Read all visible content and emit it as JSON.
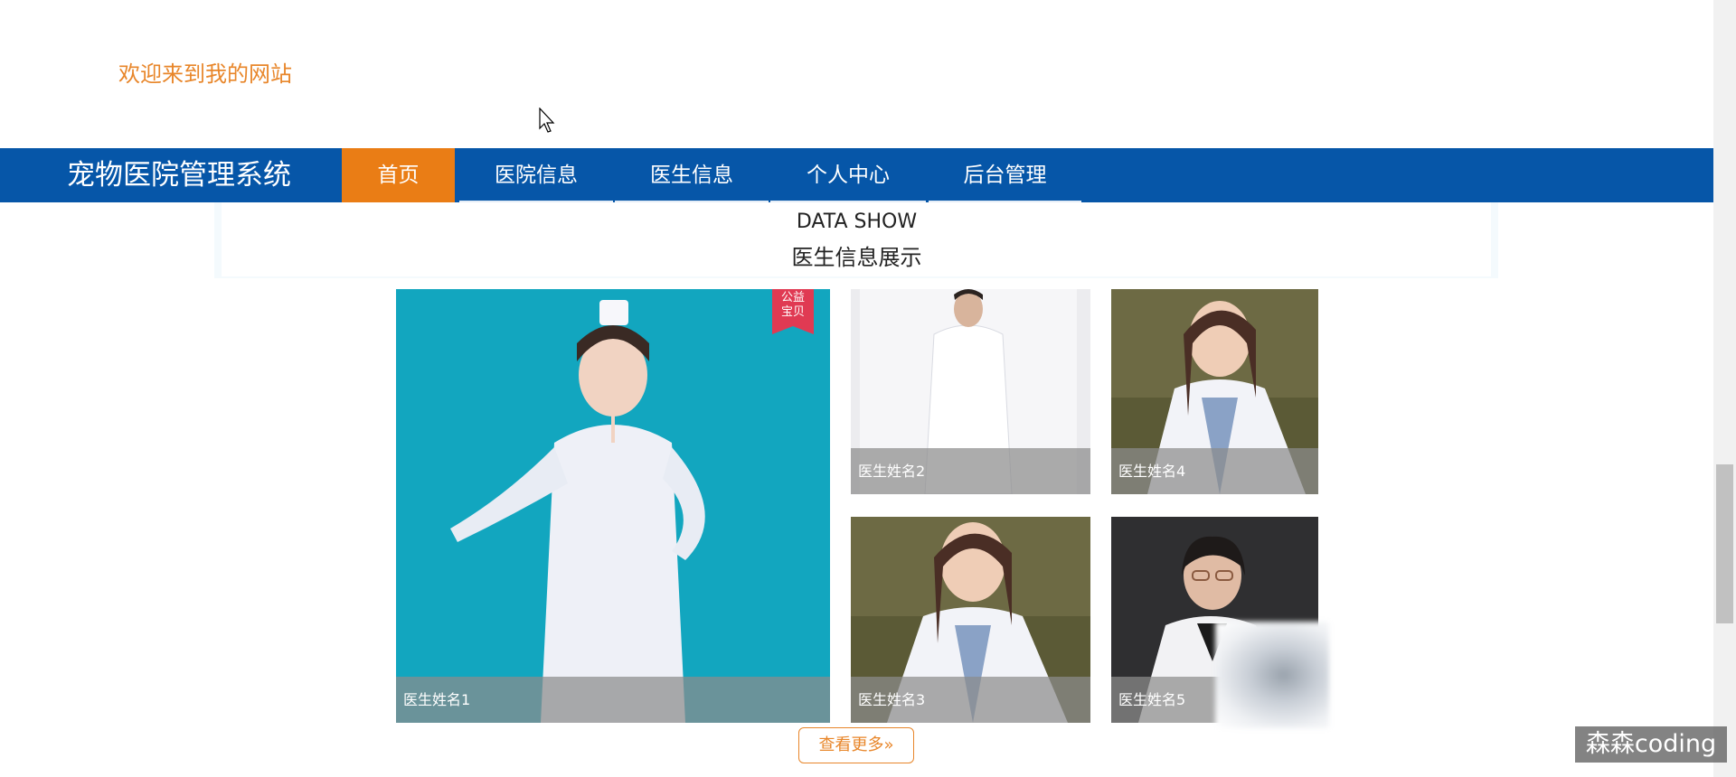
{
  "header": {
    "welcome_text": "欢迎来到我的网站"
  },
  "nav": {
    "brand": "宠物医院管理系统",
    "items": [
      {
        "label": "首页",
        "active": true
      },
      {
        "label": "医院信息",
        "active": false
      },
      {
        "label": "医生信息",
        "active": false
      },
      {
        "label": "个人中心",
        "active": false
      },
      {
        "label": "后台管理",
        "active": false
      }
    ],
    "colors": {
      "bar": "#0656a8",
      "active": "#ea7d15"
    }
  },
  "section": {
    "title_en": "DATA SHOW",
    "title_cn": "医生信息展示"
  },
  "doctors": [
    {
      "name": "医生姓名1",
      "badge": "公益宝贝"
    },
    {
      "name": "医生姓名2"
    },
    {
      "name": "医生姓名3"
    },
    {
      "name": "医生姓名4"
    },
    {
      "name": "医生姓名5"
    }
  ],
  "more_button": {
    "label": "查看更多",
    "icon": "double-chevron-right-icon"
  },
  "watermark": "森森coding",
  "colors": {
    "accent": "#e8862a"
  }
}
